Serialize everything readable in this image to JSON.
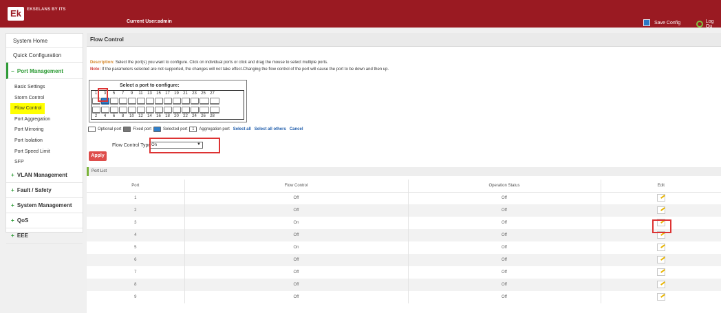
{
  "header": {
    "brand": "EKSELANS BY ITS",
    "current_user": "Current User:admin",
    "save_config": "Save Config",
    "logout": "Log Ou"
  },
  "sidebar": {
    "system_home": "System Home",
    "quick_config": "Quick Configuration",
    "port_management": "Port Management",
    "sub_items": [
      "Basic Settings",
      "Storm Control",
      "Flow Control",
      "Port Aggregation",
      "Port Mirroring",
      "Port Isolation",
      "Port Speed Limit",
      "SFP"
    ],
    "groups": [
      "VLAN Management",
      "Fault / Safety",
      "System Management",
      "QoS",
      "EEE"
    ]
  },
  "content": {
    "title": "Flow Control",
    "description_label": "Description:",
    "description": "Select the port(s) you want to configure. Click on individual ports or click and drag the mouse to select multiple ports.",
    "note_label": "Note:",
    "note": "If the parameters selected are not supported, the changes will not take effect.Changing the flow control of the port will cause the port to be down and then up.",
    "select_port_title": "Select a port to configure:",
    "top_ports": [
      "1",
      "3",
      "5",
      "7",
      "9",
      "11",
      "13",
      "15",
      "17",
      "19",
      "21",
      "23",
      "25",
      "27"
    ],
    "bottom_ports": [
      "2",
      "4",
      "6",
      "8",
      "10",
      "12",
      "14",
      "16",
      "18",
      "20",
      "22",
      "24",
      "26",
      "28"
    ],
    "legend": {
      "optional": "Optional port",
      "fixed": "Fixed port",
      "selected": "Selected port",
      "aggregation": "Aggregation port",
      "aggregation_num": "1",
      "select_all": "Select all",
      "select_others": "Select all others",
      "cancel": "Cancel"
    },
    "flow_control_type_label": "Flow Control Type:",
    "flow_control_type_value": "On",
    "apply": "Apply",
    "port_list_title": "Port List"
  },
  "table": {
    "headers": [
      "Port",
      "Flow Control",
      "Operation Status",
      "Edit"
    ],
    "rows": [
      [
        "1",
        "Off",
        "Off"
      ],
      [
        "2",
        "Off",
        "Off"
      ],
      [
        "3",
        "On",
        "Off"
      ],
      [
        "4",
        "Off",
        "Off"
      ],
      [
        "5",
        "On",
        "Off"
      ],
      [
        "6",
        "Off",
        "Off"
      ],
      [
        "7",
        "Off",
        "Off"
      ],
      [
        "8",
        "Off",
        "Off"
      ],
      [
        "9",
        "Off",
        "Off"
      ]
    ]
  }
}
